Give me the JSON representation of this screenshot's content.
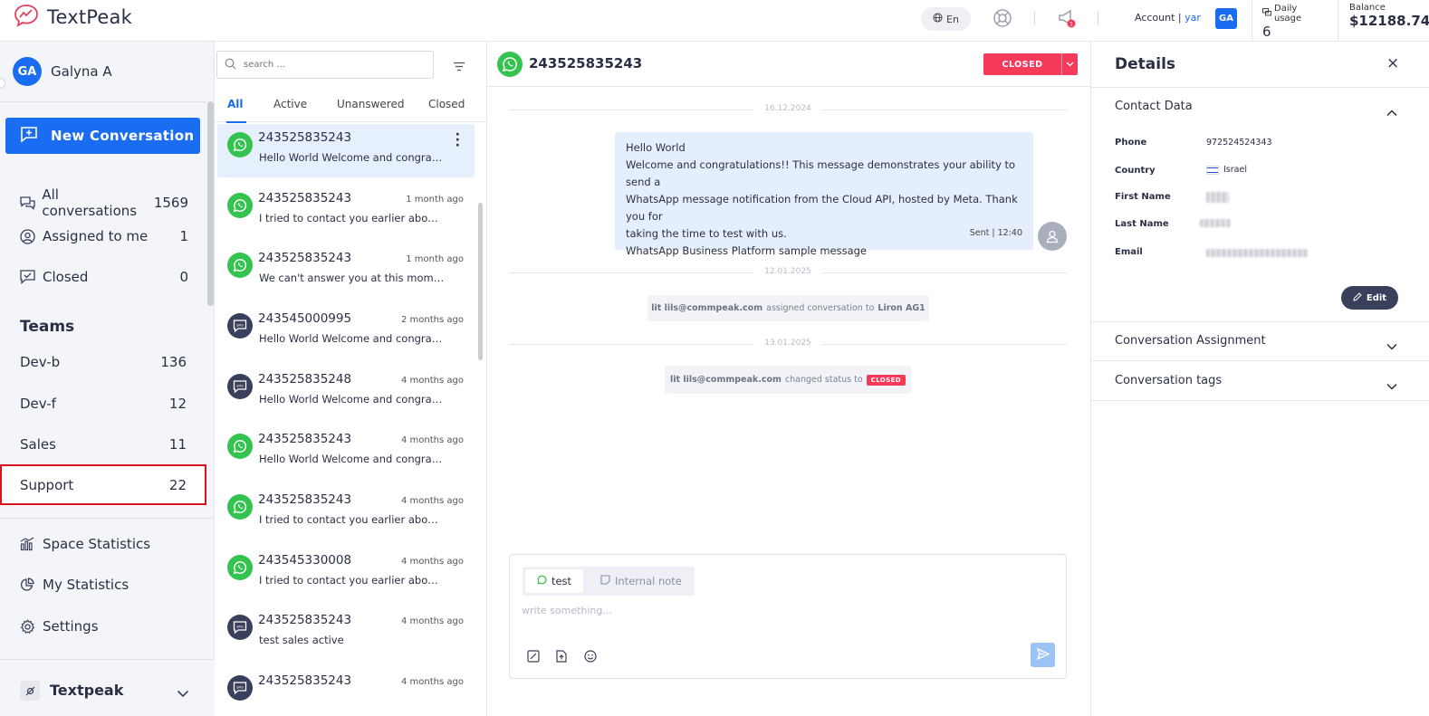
{
  "app": {
    "name": "TextPeak"
  },
  "topbar": {
    "language": "En",
    "account_label": "Account |",
    "account_user": "yar",
    "user_initials": "GA",
    "daily_usage_label": "Daily usage",
    "daily_usage_value": "6",
    "balance_label": "Balance",
    "balance_value": "$12188.74",
    "notification_count": "1"
  },
  "sidebar": {
    "user_initials": "GA",
    "user_name": "Galyna A",
    "new_conversation": "New Conversation",
    "nav": [
      {
        "label": "All conversations",
        "count": "1569",
        "icon": "chat-bubbles-icon"
      },
      {
        "label": "Assigned to me",
        "count": "1",
        "icon": "user-circle-icon"
      },
      {
        "label": "Closed",
        "count": "0",
        "icon": "check-chat-icon"
      }
    ],
    "teams_heading": "Teams",
    "teams": [
      {
        "label": "Dev-b",
        "count": "136"
      },
      {
        "label": "Dev-f",
        "count": "12"
      },
      {
        "label": "Sales",
        "count": "11"
      },
      {
        "label": "Support",
        "count": "22"
      }
    ],
    "bottom_nav": [
      {
        "label": "Space Statistics",
        "icon": "bar-chart-icon"
      },
      {
        "label": "My Statistics",
        "icon": "pie-chart-icon"
      },
      {
        "label": "Settings",
        "icon": "gear-icon"
      }
    ],
    "workspace": "Textpeak"
  },
  "list": {
    "search_placeholder": "search ...",
    "tabs": [
      "All",
      "Active",
      "Unanswered",
      "Closed"
    ],
    "active_tab": "All",
    "conversations": [
      {
        "number": "243525835243",
        "time": "",
        "preview": "Hello World Welcome and congratulations!! This message",
        "channel": "whatsapp",
        "selected": true
      },
      {
        "number": "243525835243",
        "time": "1 month ago",
        "preview": "I tried to contact you earlier about your request",
        "channel": "whatsapp"
      },
      {
        "number": "243525835243",
        "time": "1 month ago",
        "preview": "We can't answer you at this moment, please try later",
        "channel": "whatsapp"
      },
      {
        "number": "243545000995",
        "time": "2 months ago",
        "preview": "Hello World Welcome and congratulations!! This message",
        "channel": "sms"
      },
      {
        "number": "243525835248",
        "time": "4 months ago",
        "preview": "Hello World Welcome and congratulations!! This message",
        "channel": "sms"
      },
      {
        "number": "243525835243",
        "time": "4 months ago",
        "preview": "Hello World Welcome and congratulations!! This message",
        "channel": "whatsapp"
      },
      {
        "number": "243525835243",
        "time": "4 months ago",
        "preview": "I tried to contact you earlier about your request",
        "channel": "whatsapp"
      },
      {
        "number": "243545330008",
        "time": "4 months ago",
        "preview": "I tried to contact you earlier about your request",
        "channel": "whatsapp"
      },
      {
        "number": "243525835243",
        "time": "4 months ago",
        "preview": "test sales active",
        "channel": "sms"
      },
      {
        "number": "243525835243",
        "time": "4 months ago",
        "preview": "",
        "channel": "sms"
      }
    ]
  },
  "chat": {
    "number": "243525835243",
    "status": "CLOSED",
    "date1": "16.12.2024",
    "message_lines": [
      "Hello World",
      "Welcome and congratulations!! This message demonstrates your ability to send a",
      "WhatsApp message notification from the Cloud API, hosted by Meta. Thank you for",
      "taking the time to test with us.",
      "WhatsApp Business Platform sample message"
    ],
    "message_meta": "Sent | 12:40",
    "date2": "12.01.2025",
    "sys1_user": "lit lils@commpeak.com",
    "sys1_text": "assigned conversation to",
    "sys1_target": "Liron AG1",
    "date3": "13.01.2025",
    "sys2_user": "lit lils@commpeak.com",
    "sys2_text": "changed status to",
    "sys2_badge": "CLOSED",
    "composer_tab1": "test",
    "composer_tab2": "Internal note",
    "composer_placeholder": "write something..."
  },
  "details": {
    "title": "Details",
    "close": "×",
    "contact_section": "Contact Data",
    "fields": {
      "phone_label": "Phone",
      "phone_value": "972524524343",
      "country_label": "Country",
      "country_value": "Israel",
      "first_name_label": "First Name",
      "last_name_label": "Last Name",
      "email_label": "Email"
    },
    "edit_label": "Edit",
    "assignment_section": "Conversation Assignment",
    "tags_section": "Conversation tags"
  },
  "colors": {
    "accent": "#1a6cf0",
    "status_closed": "#f53a5a",
    "whatsapp": "#35c34f",
    "sms": "#3a3f5c",
    "highlight_border": "#d9151b"
  }
}
